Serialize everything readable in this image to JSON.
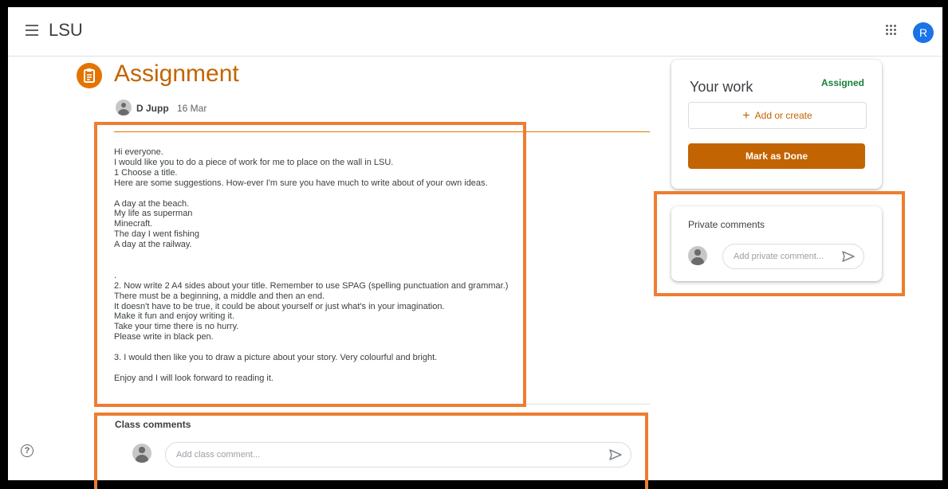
{
  "topbar": {
    "menu_icon": "hamburger-menu-icon",
    "app_title": "LSU",
    "apps_icon": "apps-grid-icon",
    "avatar_initial": "R"
  },
  "assignment": {
    "icon": "assignment-icon",
    "title": "Assignment",
    "author": "D Jupp",
    "date": "16 Mar",
    "body_lines": [
      "Hi everyone.",
      "I would like you to do a piece of work for me to place on the wall in LSU.",
      "1 Choose a title.",
      "Here are some suggestions. How-ever I'm sure you have much to write about of your own ideas.",
      "",
      "A day at the beach.",
      "My life as superman",
      "Minecraft.",
      "The day I went fishing",
      "A day at the railway.",
      "",
      "",
      ".",
      "2. Now write 2 A4 sides about your title. Remember to use SPAG (spelling punctuation and grammar.)",
      "There must be a beginning, a middle and then an end.",
      "It doesn't have to be true, it could be about yourself or just what's in your imagination.",
      "Make it fun and enjoy writing it.",
      "Take your time there is no hurry.",
      "Please write in black pen.",
      "",
      "3. I would then like you to draw a picture about your story. Very colourful and bright.",
      "",
      "Enjoy and I will look forward to reading it."
    ]
  },
  "class_comments": {
    "title": "Class comments",
    "placeholder": "Add class comment..."
  },
  "your_work": {
    "title": "Your work",
    "status": "Assigned",
    "add_label": "Add or create",
    "done_label": "Mark as Done"
  },
  "private_comments": {
    "title": "Private comments",
    "placeholder": "Add private comment..."
  },
  "colors": {
    "accent": "#c26401",
    "highlight": "#ed7d31",
    "status_green": "#188038"
  }
}
